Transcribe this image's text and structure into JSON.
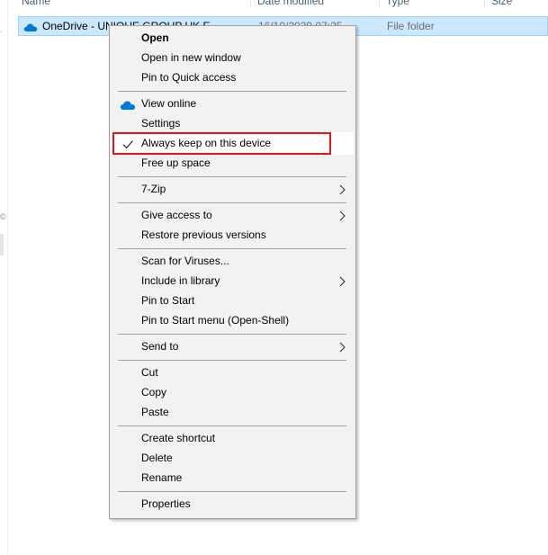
{
  "explorer": {
    "columns": {
      "name": "Name",
      "date_modified": "Date modified",
      "type": "Type",
      "size": "Size"
    },
    "row": {
      "name": "OneDrive - UNIQUE GROUP UK E",
      "date": "16/10/2020 07:25",
      "type": "File folder",
      "icon": "onedrive-cloud-icon"
    }
  },
  "context_menu": {
    "open": "Open",
    "open_new_window": "Open in new window",
    "pin_quick_access": "Pin to Quick access",
    "view_online": "View online",
    "settings": "Settings",
    "always_keep": "Always keep on this device",
    "free_up_space": "Free up space",
    "seven_zip": "7-Zip",
    "give_access": "Give access to",
    "restore_versions": "Restore previous versions",
    "scan_viruses": "Scan for Viruses...",
    "include_library": "Include in library",
    "pin_start": "Pin to Start",
    "pin_start_openshell": "Pin to Start menu (Open-Shell)",
    "send_to": "Send to",
    "cut": "Cut",
    "copy": "Copy",
    "paste": "Paste",
    "create_shortcut": "Create shortcut",
    "delete": "Delete",
    "rename": "Rename",
    "properties": "Properties"
  },
  "colors": {
    "selection": "#cce8ff",
    "onedrive_blue": "#0078d4",
    "highlight_border": "#e3141e",
    "menu_bg": "#f2f2f2"
  }
}
